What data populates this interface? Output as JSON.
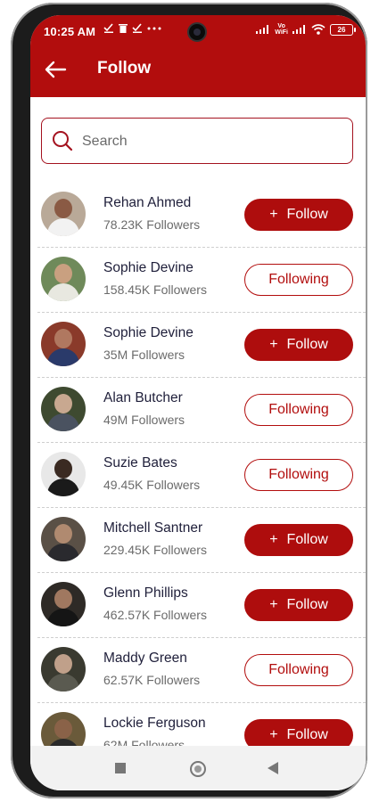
{
  "status": {
    "time": "10:25 AM",
    "battery": "26",
    "vowifi_top": "Vo",
    "vowifi_bottom": "WiFi"
  },
  "header": {
    "title": "Follow"
  },
  "search": {
    "placeholder": "Search"
  },
  "colors": {
    "accent": "#b20d0d",
    "name_text": "#1f1f3a",
    "subtext": "#6b6b6b"
  },
  "users": [
    {
      "name": "Rehan Ahmed",
      "followers": "78.23K Followers",
      "status": "follow",
      "label": "Follow"
    },
    {
      "name": "Sophie Devine",
      "followers": "158.45K Followers",
      "status": "following",
      "label": "Following"
    },
    {
      "name": "Sophie Devine",
      "followers": "35M Followers",
      "status": "follow",
      "label": "Follow"
    },
    {
      "name": "Alan Butcher",
      "followers": "49M Followers",
      "status": "following",
      "label": "Following"
    },
    {
      "name": "Suzie Bates",
      "followers": "49.45K Followers",
      "status": "following",
      "label": "Following"
    },
    {
      "name": "Mitchell Santner",
      "followers": "229.45K Followers",
      "status": "follow",
      "label": "Follow"
    },
    {
      "name": "Glenn Phillips",
      "followers": "462.57K Followers",
      "status": "follow",
      "label": "Follow"
    },
    {
      "name": "Maddy Green",
      "followers": "62.57K Followers",
      "status": "following",
      "label": "Following"
    },
    {
      "name": "Lockie Ferguson",
      "followers": "62M Followers",
      "status": "follow",
      "label": "Follow"
    }
  ],
  "icons": {
    "back": "arrow-left-icon",
    "search": "search-icon",
    "nav": [
      "recent-apps-icon",
      "home-icon",
      "back-triangle-icon"
    ]
  }
}
